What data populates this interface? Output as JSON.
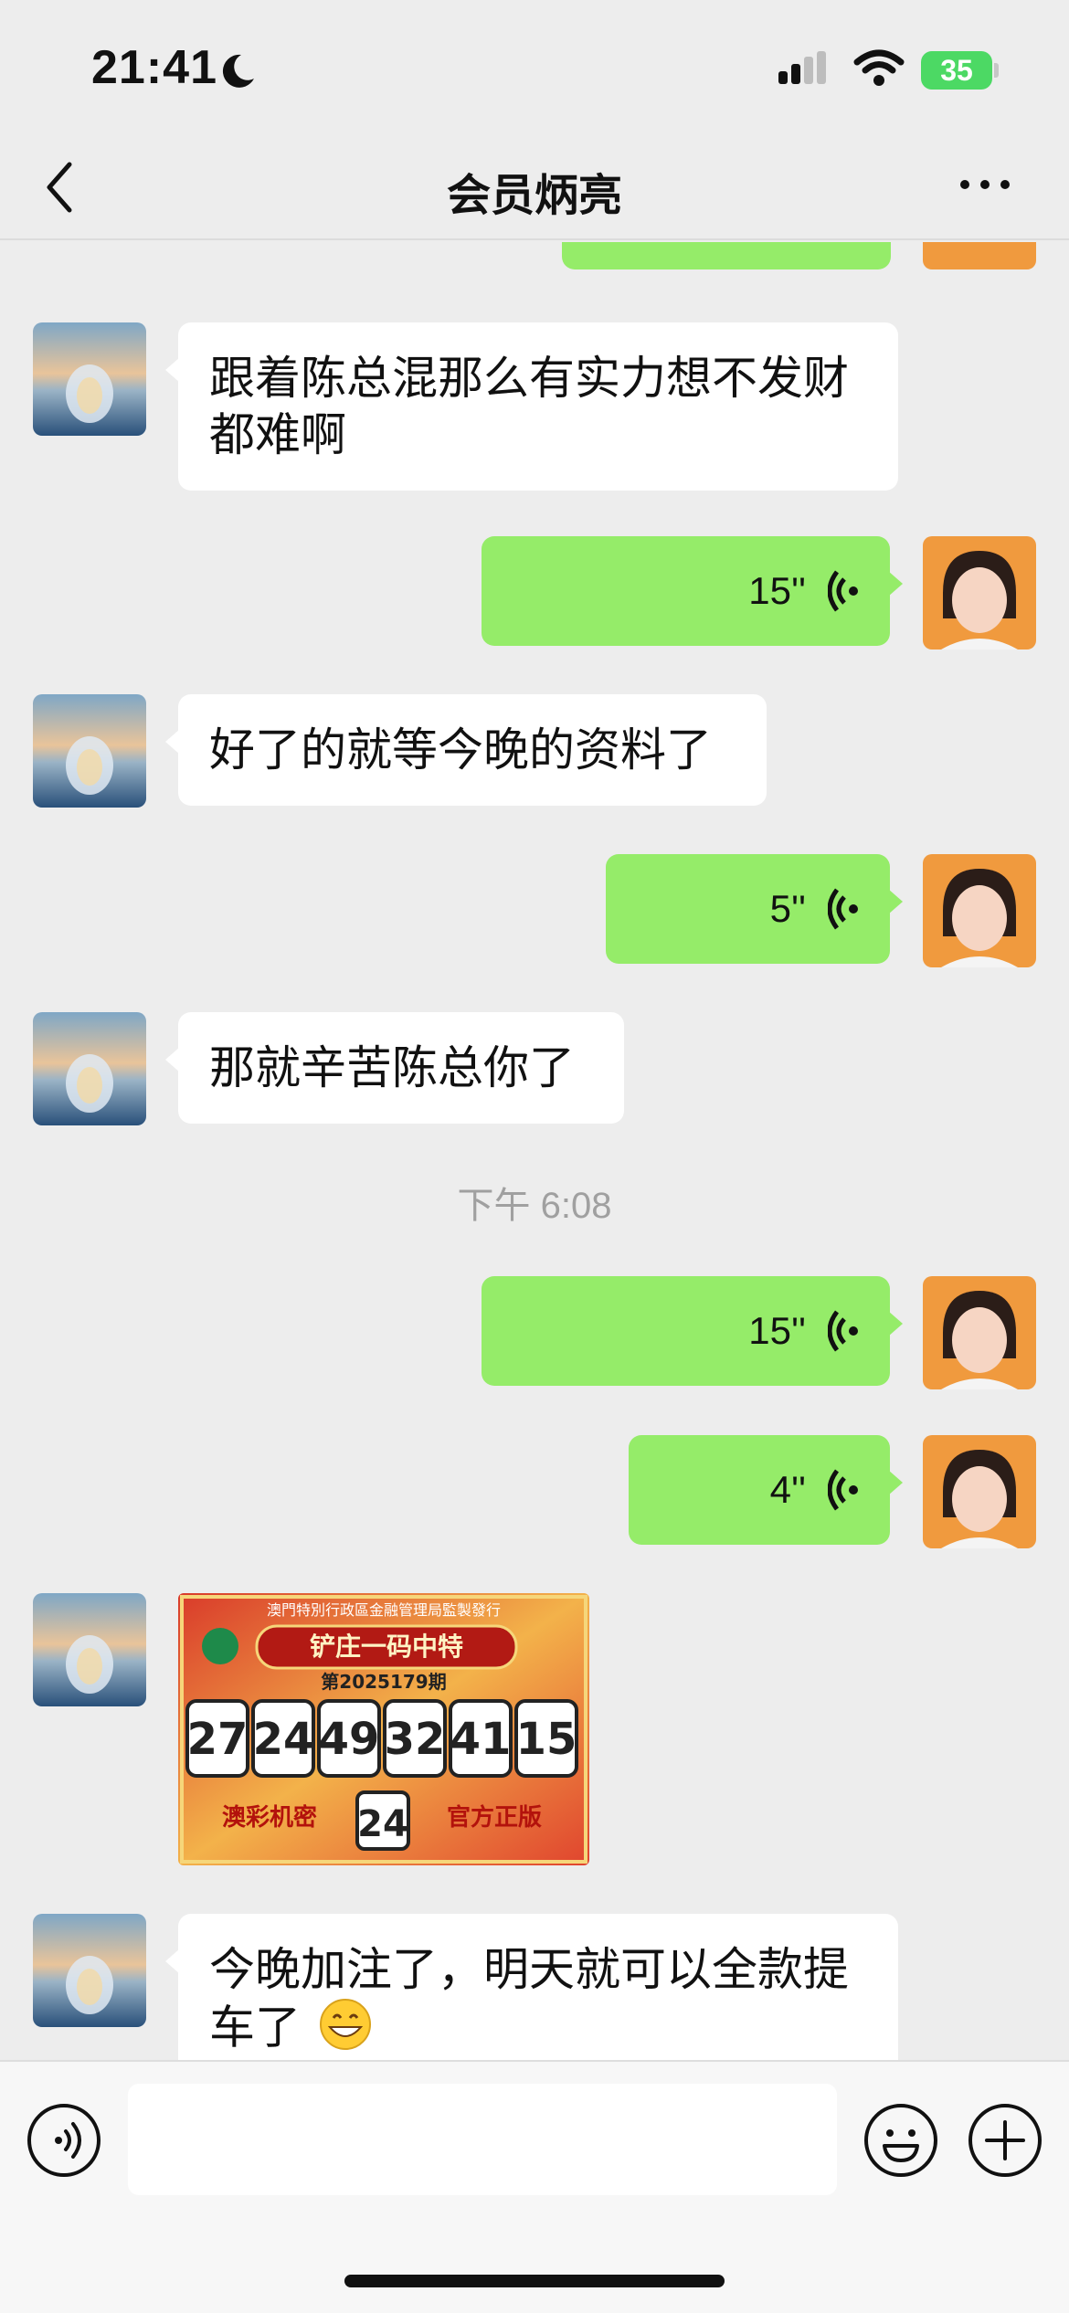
{
  "status_bar": {
    "time": "21:41",
    "battery": "35"
  },
  "header": {
    "title": "会员炳亮"
  },
  "messages": {
    "m1": "跟着陈总混那么有实力想不发财都难啊",
    "v1": "15''",
    "m2": "好了的就等今晚的资料了",
    "v2": "5''",
    "m3": "那就辛苦陈总你了",
    "timestamp": "下午 6:08",
    "v3": "15''",
    "v4": "4''",
    "m4": "今晚加注了，明天就可以全款提车了"
  },
  "lottery_image": {
    "header": "澳門特別行政區金融管理局監製發行",
    "banner": "铲庄一码中特",
    "issue": "第2025179期",
    "numbers": [
      "27",
      "24",
      "49",
      "32",
      "41",
      "15"
    ],
    "left_text": "澳彩机密",
    "special": "24",
    "right_text": "官方正版"
  },
  "input": {
    "placeholder": ""
  },
  "colors": {
    "incoming_bubble": "#ffffff",
    "outgoing_bubble": "#95ec69",
    "background": "#ededed"
  }
}
